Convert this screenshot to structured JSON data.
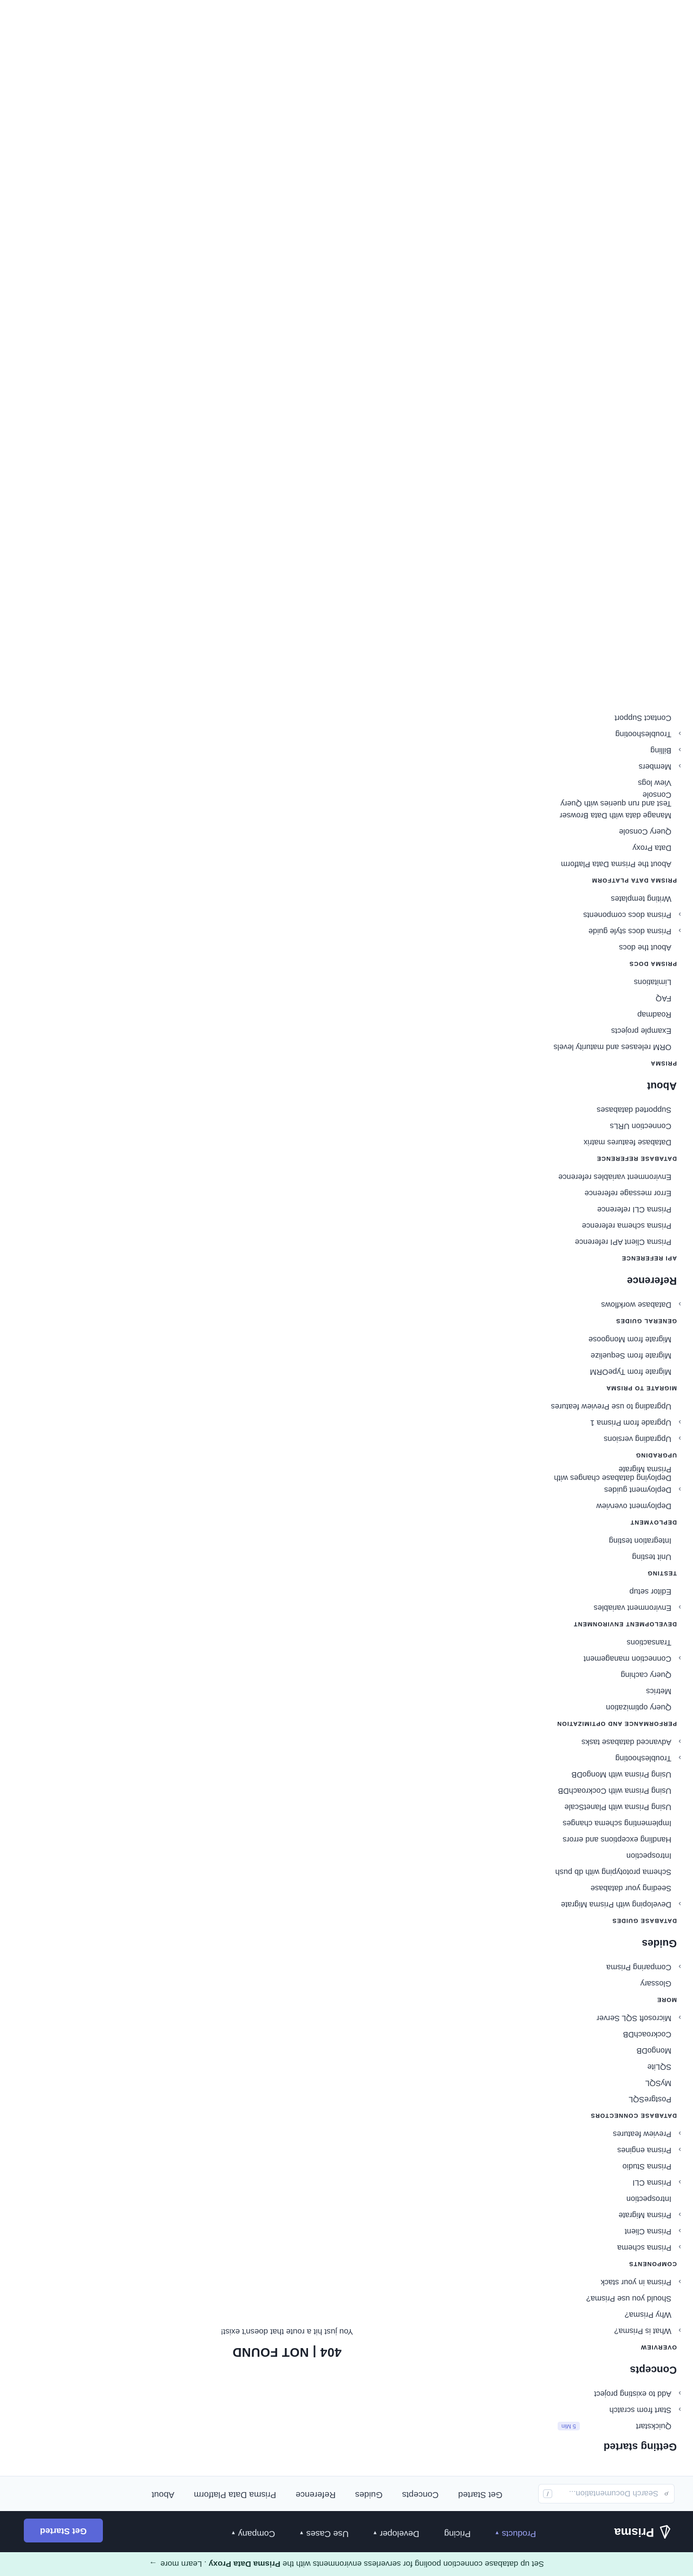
{
  "announcement": {
    "pre": "Set up database connection pooling for serverless environments with the",
    "product": "Prisma Data Proxy",
    "post": ". Learn more",
    "arrow": "→"
  },
  "nav": {
    "logo_text": "Prisma",
    "links": [
      {
        "label": "Products",
        "chevron": true,
        "active": true
      },
      {
        "label": "Pricing",
        "chevron": false,
        "active": false
      },
      {
        "label": "Developer",
        "chevron": true,
        "active": false
      },
      {
        "label": "Use Cases",
        "chevron": true,
        "active": false
      },
      {
        "label": "Company",
        "chevron": true,
        "active": false
      }
    ],
    "cta": "Get Started"
  },
  "subnav": {
    "search_placeholder": "Search Documentation...",
    "search_shortcut": "/",
    "tabs": [
      "Get Started",
      "Concepts",
      "Guides",
      "Reference",
      "Prisma Data Platform",
      "About"
    ]
  },
  "sidebar": [
    {
      "type": "h2",
      "label": "Getting started"
    },
    {
      "type": "item",
      "label": "Quickstart",
      "badge": "5 Min"
    },
    {
      "type": "item",
      "label": "Start from scratch",
      "expandable": true
    },
    {
      "type": "item",
      "label": "Add to existing project",
      "expandable": true
    },
    {
      "type": "h2",
      "label": "Concepts"
    },
    {
      "type": "h4",
      "label": "OVERVIEW"
    },
    {
      "type": "item",
      "label": "What is Prisma?",
      "expandable": true
    },
    {
      "type": "item",
      "label": "Why Prisma?"
    },
    {
      "type": "item",
      "label": "Should you use Prisma?"
    },
    {
      "type": "item",
      "label": "Prisma in your stack",
      "expandable": true
    },
    {
      "type": "h4",
      "label": "COMPONENTS"
    },
    {
      "type": "item",
      "label": "Prisma schema",
      "expandable": true
    },
    {
      "type": "item",
      "label": "Prisma Client",
      "expandable": true
    },
    {
      "type": "item",
      "label": "Prisma Migrate",
      "expandable": true
    },
    {
      "type": "item",
      "label": "Introspection"
    },
    {
      "type": "item",
      "label": "Prisma CLI",
      "expandable": true
    },
    {
      "type": "item",
      "label": "Prisma Studio"
    },
    {
      "type": "item",
      "label": "Prisma engines",
      "expandable": true
    },
    {
      "type": "item",
      "label": "Preview features",
      "expandable": true
    },
    {
      "type": "h4",
      "label": "DATABASE CONNECTORS"
    },
    {
      "type": "item",
      "label": "PostgreSQL"
    },
    {
      "type": "item",
      "label": "MySQL"
    },
    {
      "type": "item",
      "label": "SQLite"
    },
    {
      "type": "item",
      "label": "MongoDB"
    },
    {
      "type": "item",
      "label": "CockroachDB"
    },
    {
      "type": "item",
      "label": "Microsoft SQL Server",
      "expandable": true
    },
    {
      "type": "h4",
      "label": "MORE"
    },
    {
      "type": "item",
      "label": "Glossary"
    },
    {
      "type": "item",
      "label": "Comparing Prisma",
      "expandable": true
    },
    {
      "type": "h2",
      "label": "Guides"
    },
    {
      "type": "h4",
      "label": "DATABASE GUIDES"
    },
    {
      "type": "item",
      "label": "Developing with Prisma Migrate",
      "expandable": true
    },
    {
      "type": "item",
      "label": "Seeding your database"
    },
    {
      "type": "item",
      "label": "Schema prototyping with db push"
    },
    {
      "type": "item",
      "label": "Introspection"
    },
    {
      "type": "item",
      "label": "Handling exceptions and errors"
    },
    {
      "type": "item",
      "label": "Implementing schema changes"
    },
    {
      "type": "item",
      "label": "Using Prisma with PlanetScale"
    },
    {
      "type": "item",
      "label": "Using Prisma with CockroachDB"
    },
    {
      "type": "item",
      "label": "Using Prisma with MongoDB"
    },
    {
      "type": "item",
      "label": "Troubleshooting",
      "expandable": true
    },
    {
      "type": "item",
      "label": "Advanced database tasks",
      "expandable": true
    },
    {
      "type": "h4",
      "label": "PERFORMANCE AND OPTIMIZATION"
    },
    {
      "type": "item",
      "label": "Query optimization"
    },
    {
      "type": "item",
      "label": "Metrics"
    },
    {
      "type": "item",
      "label": "Query caching"
    },
    {
      "type": "item",
      "label": "Connection management",
      "expandable": true
    },
    {
      "type": "item",
      "label": "Transactions"
    },
    {
      "type": "h4",
      "label": "DEVELOPMENT ENVIRONMENT"
    },
    {
      "type": "item",
      "label": "Environment variables",
      "expandable": true
    },
    {
      "type": "item",
      "label": "Editor setup"
    },
    {
      "type": "h4",
      "label": "TESTING"
    },
    {
      "type": "item",
      "label": "Unit testing"
    },
    {
      "type": "item",
      "label": "Integration testing"
    },
    {
      "type": "h4",
      "label": "DEPLOYMENT"
    },
    {
      "type": "item",
      "label": "Deployment overview"
    },
    {
      "type": "item",
      "label": "Deployment guides",
      "expandable": true
    },
    {
      "type": "item",
      "label": "Deploying database changes with Prisma Migrate"
    },
    {
      "type": "h4",
      "label": "UPGRADING"
    },
    {
      "type": "item",
      "label": "Upgrading versions",
      "expandable": true
    },
    {
      "type": "item",
      "label": "Upgrade from Prisma 1",
      "expandable": true
    },
    {
      "type": "item",
      "label": "Upgrading to use Preview features"
    },
    {
      "type": "h4",
      "label": "MIGRATE TO PRISMA"
    },
    {
      "type": "item",
      "label": "Migrate from TypeORM"
    },
    {
      "type": "item",
      "label": "Migrate from Sequelize"
    },
    {
      "type": "item",
      "label": "Migrate from Mongoose"
    },
    {
      "type": "h4",
      "label": "GENERAL GUIDES"
    },
    {
      "type": "item",
      "label": "Database workflows",
      "expandable": true
    },
    {
      "type": "h2",
      "label": "Reference"
    },
    {
      "type": "h4",
      "label": "API REFERENCE"
    },
    {
      "type": "item",
      "label": "Prisma Client API reference"
    },
    {
      "type": "item",
      "label": "Prisma schema reference"
    },
    {
      "type": "item",
      "label": "Prisma CLI reference"
    },
    {
      "type": "item",
      "label": "Error message reference"
    },
    {
      "type": "item",
      "label": "Environment variables reference"
    },
    {
      "type": "h4",
      "label": "DATABASE REFERENCE"
    },
    {
      "type": "item",
      "label": "Database features matrix"
    },
    {
      "type": "item",
      "label": "Connection URLs"
    },
    {
      "type": "item",
      "label": "Supported databases"
    },
    {
      "type": "h2",
      "label": "About"
    },
    {
      "type": "h4",
      "label": "PRISMA"
    },
    {
      "type": "item",
      "label": "ORM releases and maturity levels"
    },
    {
      "type": "item",
      "label": "Example projects"
    },
    {
      "type": "item",
      "label": "Roadmap"
    },
    {
      "type": "item",
      "label": "FAQ"
    },
    {
      "type": "item",
      "label": "Limitations"
    },
    {
      "type": "h4",
      "label": "PRISMA DOCS"
    },
    {
      "type": "item",
      "label": "About the docs"
    },
    {
      "type": "item",
      "label": "Prisma docs style guide",
      "expandable": true
    },
    {
      "type": "item",
      "label": "Prisma docs components",
      "expandable": true
    },
    {
      "type": "item",
      "label": "Writing templates"
    },
    {
      "type": "h4",
      "label": "PRISMA DATA PLATFORM"
    },
    {
      "type": "item",
      "label": "About the Prisma Data Platform"
    },
    {
      "type": "item",
      "label": "Data Proxy"
    },
    {
      "type": "item",
      "label": "Query Console"
    },
    {
      "type": "item",
      "label": "Manage data with Data Browser"
    },
    {
      "type": "item",
      "label": "Test and run queries with Query Console"
    },
    {
      "type": "item",
      "label": "View logs"
    },
    {
      "type": "item",
      "label": "Members",
      "expandable": true
    },
    {
      "type": "item",
      "label": "Billing",
      "expandable": true
    },
    {
      "type": "item",
      "label": "Troubleshooting",
      "expandable": true
    },
    {
      "type": "item",
      "label": "Contact Support"
    }
  ],
  "main": {
    "title": "404 | NOT FOUND",
    "message": "You just hit a route that doesn't exist!"
  }
}
